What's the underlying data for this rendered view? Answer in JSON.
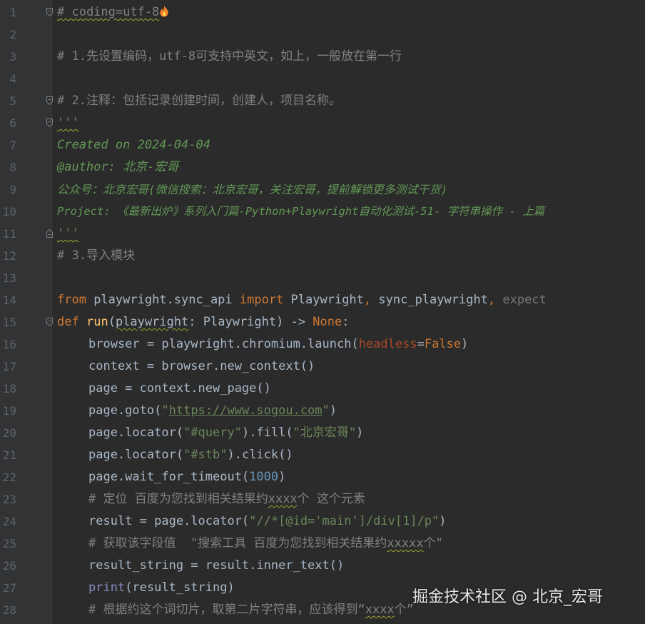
{
  "editor": {
    "line_numbers": [
      "1",
      "2",
      "3",
      "4",
      "5",
      "6",
      "7",
      "8",
      "9",
      "10",
      "11",
      "12",
      "13",
      "14",
      "15",
      "16",
      "17",
      "18",
      "19",
      "20",
      "21",
      "22",
      "23",
      "24",
      "25",
      "26",
      "27",
      "28"
    ],
    "code": {
      "l1": {
        "text": "# coding=utf-8"
      },
      "l3": {
        "text": "# 1.先设置编码，utf-8可支持中英文，如上，一般放在第一行"
      },
      "l5": {
        "text": "# 2.注释：包括记录创建时间，创建人，项目名称。"
      },
      "l6": {
        "text": "'''"
      },
      "l7": {
        "text": "Created on 2024-04-04"
      },
      "l8": {
        "text": "@author: 北京-宏哥"
      },
      "l9": {
        "text": "公众号：北京宏哥(微信搜索：北京宏哥，关注宏哥，提前解锁更多测试干货)"
      },
      "l10": {
        "text": "Project: 《最新出炉》系列入门篇-Python+Playwright自动化测试-51- 字符串操作 - 上篇"
      },
      "l11": {
        "text": "'''"
      },
      "l12": {
        "text": "# 3.导入模块"
      },
      "l14": {
        "kw_from": "from",
        "module": " playwright.sync_api ",
        "kw_import": "import",
        "name1": " Playwright",
        "comma1": ",",
        "name2": " sync_playwright",
        "comma2": ",",
        "name3": " expect"
      },
      "l15": {
        "kw_def": "def",
        "fn_name": "run",
        "open": "(",
        "param": "playwright",
        "rest": ": Playwright) -> ",
        "kw_none": "None",
        "colon": ":"
      },
      "l16": {
        "pre": "browser = playwright.chromium.launch(",
        "param": "headless",
        "eq": "=",
        "val": "False",
        "post": ")"
      },
      "l17": {
        "text": "context = browser.new_context()"
      },
      "l18": {
        "text": "page = context.new_page()"
      },
      "l19": {
        "pre": "page.goto(",
        "q1": "\"",
        "url": "https://www.sogou.com",
        "q2": "\"",
        "post": ")"
      },
      "l20": {
        "pre": "page.locator(",
        "str1": "\"#query\"",
        "mid": ").fill(",
        "str2": "\"北京宏哥\"",
        "post": ")"
      },
      "l21": {
        "pre": "page.locator(",
        "str1": "\"#stb\"",
        "post": ").click()"
      },
      "l22": {
        "pre": "page.wait_for_timeout(",
        "num": "1000",
        "post": ")"
      },
      "l23": {
        "pre": "# 定位 百度为您找到相关结果约",
        "squig": "xxxx",
        "post": "个 这个元素"
      },
      "l24": {
        "pre": "result = page.locator(",
        "str": "\"//*[@id='main']/div[1]/p\"",
        "post": ")"
      },
      "l25": {
        "pre": "# 获取该字段值  \"搜索工具 百度为您找到相关结果约",
        "squig": "xxxxx",
        "post": "个\""
      },
      "l26": {
        "text": "result_string = result.inner_text()"
      },
      "l27": {
        "builtin": "print",
        "post": "(result_string)"
      },
      "l28": {
        "pre": "# 根据约这个词切片，取第二片字符串，应该得到“",
        "squig": "xxxx",
        "post": "个”"
      }
    }
  },
  "watermark": {
    "text": "掘金技术社区 @ 北京_宏哥"
  },
  "icons": {
    "flame": "flame-icon",
    "fold": "fold-marker-icon"
  },
  "colors": {
    "background": "#2b2b2b",
    "gutter": "#313335",
    "line_number": "#606366",
    "default_text": "#a9b7c6",
    "comment": "#808080",
    "docstring": "#629755",
    "keyword": "#cc7832",
    "function": "#ffc66d",
    "string": "#6a8759",
    "number": "#6897bb",
    "param": "#aa4926",
    "builtin": "#8888c6"
  }
}
